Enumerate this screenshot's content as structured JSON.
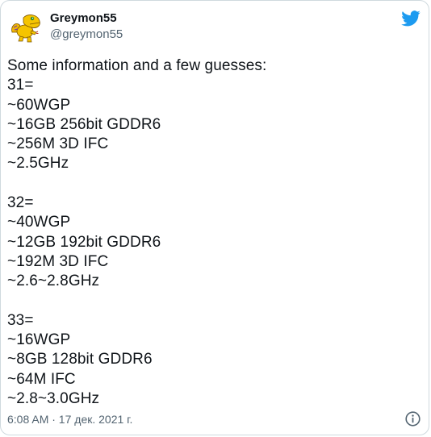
{
  "author": {
    "display_name": "Greymon55",
    "handle": "@greymon55"
  },
  "icons": {
    "avatar": "agumon-avatar",
    "brand": "twitter-bird-icon",
    "info": "info-icon"
  },
  "colors": {
    "twitter_blue": "#1d9bf0",
    "text_primary": "#0f1419",
    "text_secondary": "#536471",
    "border": "#cfd9de"
  },
  "tweet": {
    "lines": [
      "Some information and a few guesses:",
      "31=",
      "~60WGP",
      "~16GB 256bit GDDR6",
      "~256M 3D IFC",
      "~2.5GHz",
      "",
      "32=",
      "~40WGP",
      "~12GB 192bit GDDR6",
      "~192M 3D IFC",
      "~2.6~2.8GHz",
      "",
      "33=",
      "~16WGP",
      "~8GB 128bit GDDR6",
      "~64M IFC",
      "~2.8~3.0GHz"
    ]
  },
  "footer": {
    "timestamp": "6:08 AM · 17 дек. 2021 г."
  }
}
